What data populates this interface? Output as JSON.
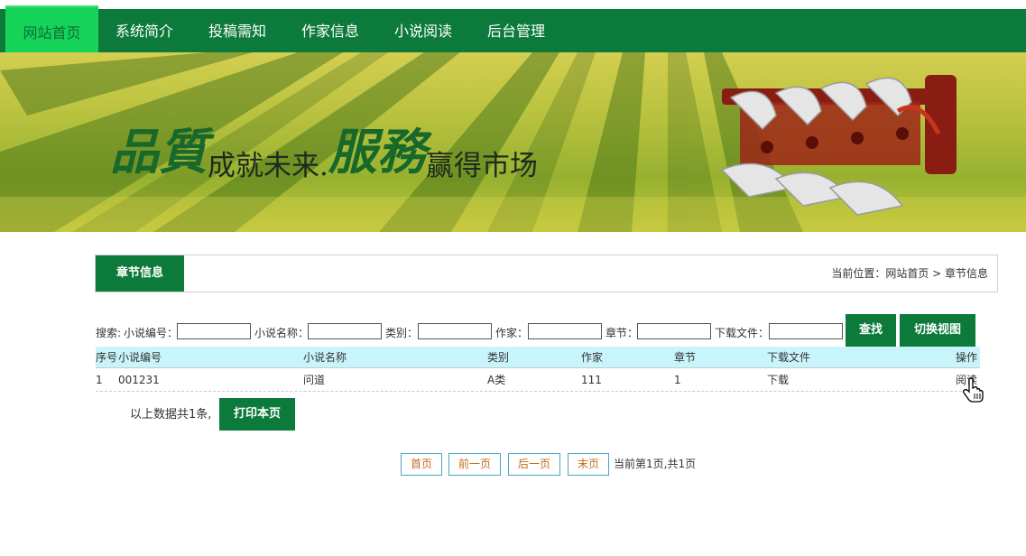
{
  "nav": {
    "items": [
      {
        "label": "网站首页",
        "active": true
      },
      {
        "label": "系统简介"
      },
      {
        "label": "投稿需知"
      },
      {
        "label": "作家信息"
      },
      {
        "label": "小说阅读"
      },
      {
        "label": "后台管理"
      }
    ]
  },
  "banner": {
    "slogan_big_1": "品質",
    "slogan_small_1": "成就未来.",
    "slogan_big_2": "服務",
    "slogan_small_2": "赢得市场"
  },
  "panel": {
    "tab_label": "章节信息",
    "breadcrumb": "当前位置：网站首页 > 章节信息"
  },
  "search": {
    "prefix": "搜索:",
    "fields": [
      {
        "label": "小说编号：",
        "value": ""
      },
      {
        "label": "小说名称：",
        "value": ""
      },
      {
        "label": "类别：",
        "value": ""
      },
      {
        "label": "作家：",
        "value": ""
      },
      {
        "label": "章节：",
        "value": ""
      },
      {
        "label": "下载文件：",
        "value": ""
      }
    ],
    "search_button": "查找",
    "switch_view_button": "切换视图"
  },
  "table": {
    "headers": [
      "序号",
      "小说编号",
      "小说名称",
      "类别",
      "作家",
      "章节",
      "下载文件",
      "操作"
    ],
    "rows": [
      [
        "1",
        "001231",
        "问道",
        "A类",
        "111",
        "1",
        "下载",
        "阅读"
      ]
    ]
  },
  "summary": {
    "text": "以上数据共1条,",
    "print_button": "打印本页"
  },
  "pagination": {
    "first": "首页",
    "prev": "前一页",
    "next": "后一页",
    "last": "末页",
    "info": "当前第1页,共1页"
  },
  "colors": {
    "brand_green": "#0b7a3b",
    "active_tab": "#16d35a",
    "table_header_bg": "#c8f5fb",
    "pager_text": "#c56a1c",
    "pager_border": "#4aa5c7"
  }
}
